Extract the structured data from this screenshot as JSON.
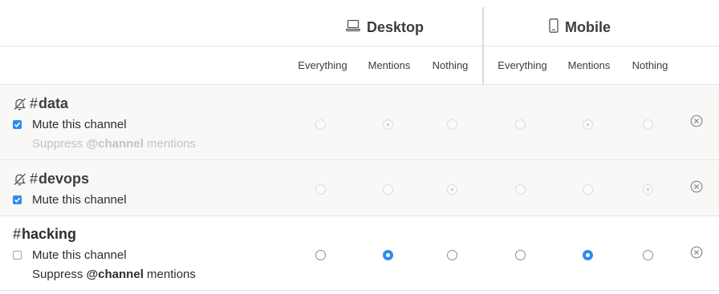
{
  "header": {
    "desktop": {
      "label": "Desktop",
      "icon": "laptop-icon"
    },
    "mobile": {
      "label": "Mobile",
      "icon": "phone-icon"
    },
    "columns": [
      "Everything",
      "Mentions",
      "Nothing",
      "Everything",
      "Mentions",
      "Nothing"
    ]
  },
  "rows": [
    {
      "hash": "#",
      "name": "data",
      "muted": true,
      "mute_label": "Mute this channel",
      "suppress_prefix": "Suppress ",
      "suppress_bold": "@channel",
      "suppress_suffix": " mentions",
      "desktop_selected": "Mentions",
      "mobile_selected": "Mentions"
    },
    {
      "hash": "#",
      "name": "devops",
      "muted": true,
      "mute_label": "Mute this channel",
      "desktop_selected": "Nothing",
      "mobile_selected": "Nothing"
    },
    {
      "hash": "#",
      "name": "hacking",
      "muted": false,
      "mute_label": "Mute this channel",
      "suppress_prefix": "Suppress ",
      "suppress_bold": "@channel",
      "suppress_suffix": " mentions",
      "desktop_selected": "Mentions",
      "mobile_selected": "Mentions"
    }
  ],
  "icons": {
    "close": "close-circle-icon",
    "muted": "bell-slash-icon"
  },
  "colors": {
    "accent": "#2d8cf0",
    "muted_row_bg": "#f8f8f6",
    "faint_text": "#c3c3c3"
  }
}
